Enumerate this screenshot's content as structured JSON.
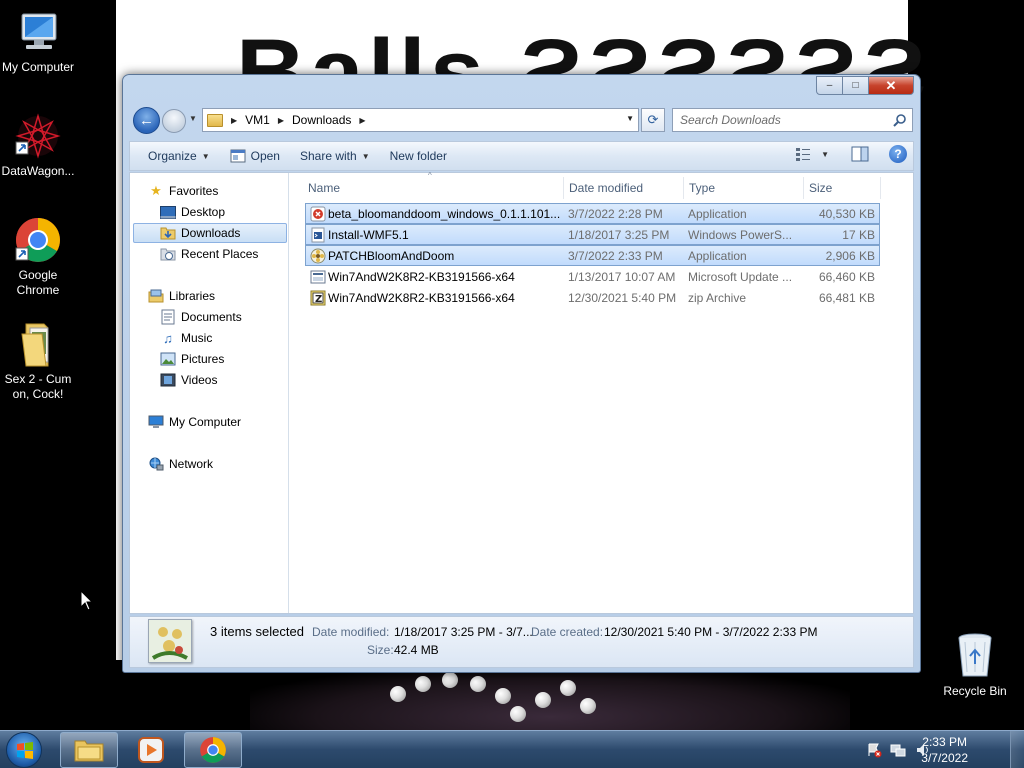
{
  "desktop": {
    "wallpaper_text": "Balls ƧƧƧƧƧƧ",
    "icons": [
      {
        "label": "My Computer",
        "icon": "computer-icon"
      },
      {
        "label": "DataWagon...",
        "icon": "datawagon-icon"
      },
      {
        "label": "Google Chrome",
        "icon": "chrome-icon"
      },
      {
        "label": "Sex 2 - Cum on, Cock!",
        "icon": "folder-icon"
      },
      {
        "label": "Recycle Bin",
        "icon": "recycle-bin-icon"
      }
    ]
  },
  "window": {
    "caption_buttons": {
      "minimize": "–",
      "maximize": "□",
      "close": "✕"
    },
    "address": {
      "crumbs": [
        "VM1",
        "Downloads"
      ]
    },
    "search": {
      "placeholder": "Search Downloads"
    },
    "toolbar": {
      "organize": "Organize",
      "open": "Open",
      "share_with": "Share with",
      "new_folder": "New folder"
    },
    "nav": {
      "favorites": "Favorites",
      "desktop": "Desktop",
      "downloads": "Downloads",
      "recent_places": "Recent Places",
      "libraries": "Libraries",
      "documents": "Documents",
      "music": "Music",
      "pictures": "Pictures",
      "videos": "Videos",
      "my_computer": "My Computer",
      "network": "Network"
    },
    "columns": {
      "name": "Name",
      "date_modified": "Date modified",
      "type": "Type",
      "size": "Size"
    },
    "files": [
      {
        "name": "beta_bloomanddoom_windows_0.1.1.101...",
        "date": "3/7/2022 2:28 PM",
        "type": "Application",
        "size": "40,530 KB",
        "selected": true,
        "icon": "app-red-icon"
      },
      {
        "name": "Install-WMF5.1",
        "date": "1/18/2017 3:25 PM",
        "type": "Windows PowerS...",
        "size": "17 KB",
        "selected": true,
        "icon": "powershell-script-icon"
      },
      {
        "name": "PATCHBloomAndDoom",
        "date": "3/7/2022 2:33 PM",
        "type": "Application",
        "size": "2,906 KB",
        "selected": true,
        "icon": "flower-app-icon"
      },
      {
        "name": "Win7AndW2K8R2-KB3191566-x64",
        "date": "1/13/2017 10:07 AM",
        "type": "Microsoft Update ...",
        "size": "66,460 KB",
        "selected": false,
        "icon": "update-package-icon"
      },
      {
        "name": "Win7AndW2K8R2-KB3191566-x64",
        "date": "12/30/2021 5:40 PM",
        "type": "zip Archive",
        "size": "66,481 KB",
        "selected": false,
        "icon": "zip-archive-icon"
      }
    ],
    "details": {
      "count": "3 items selected",
      "date_modified_label": "Date modified:",
      "date_modified_value": "1/18/2017 3:25 PM - 3/7...",
      "date_created_label": "Date created:",
      "date_created_value": "12/30/2021 5:40 PM - 3/7/2022 2:33 PM",
      "size_label": "Size:",
      "size_value": "42.4 MB"
    }
  },
  "taskbar": {
    "clock_time": "2:33 PM",
    "clock_date": "3/7/2022"
  }
}
